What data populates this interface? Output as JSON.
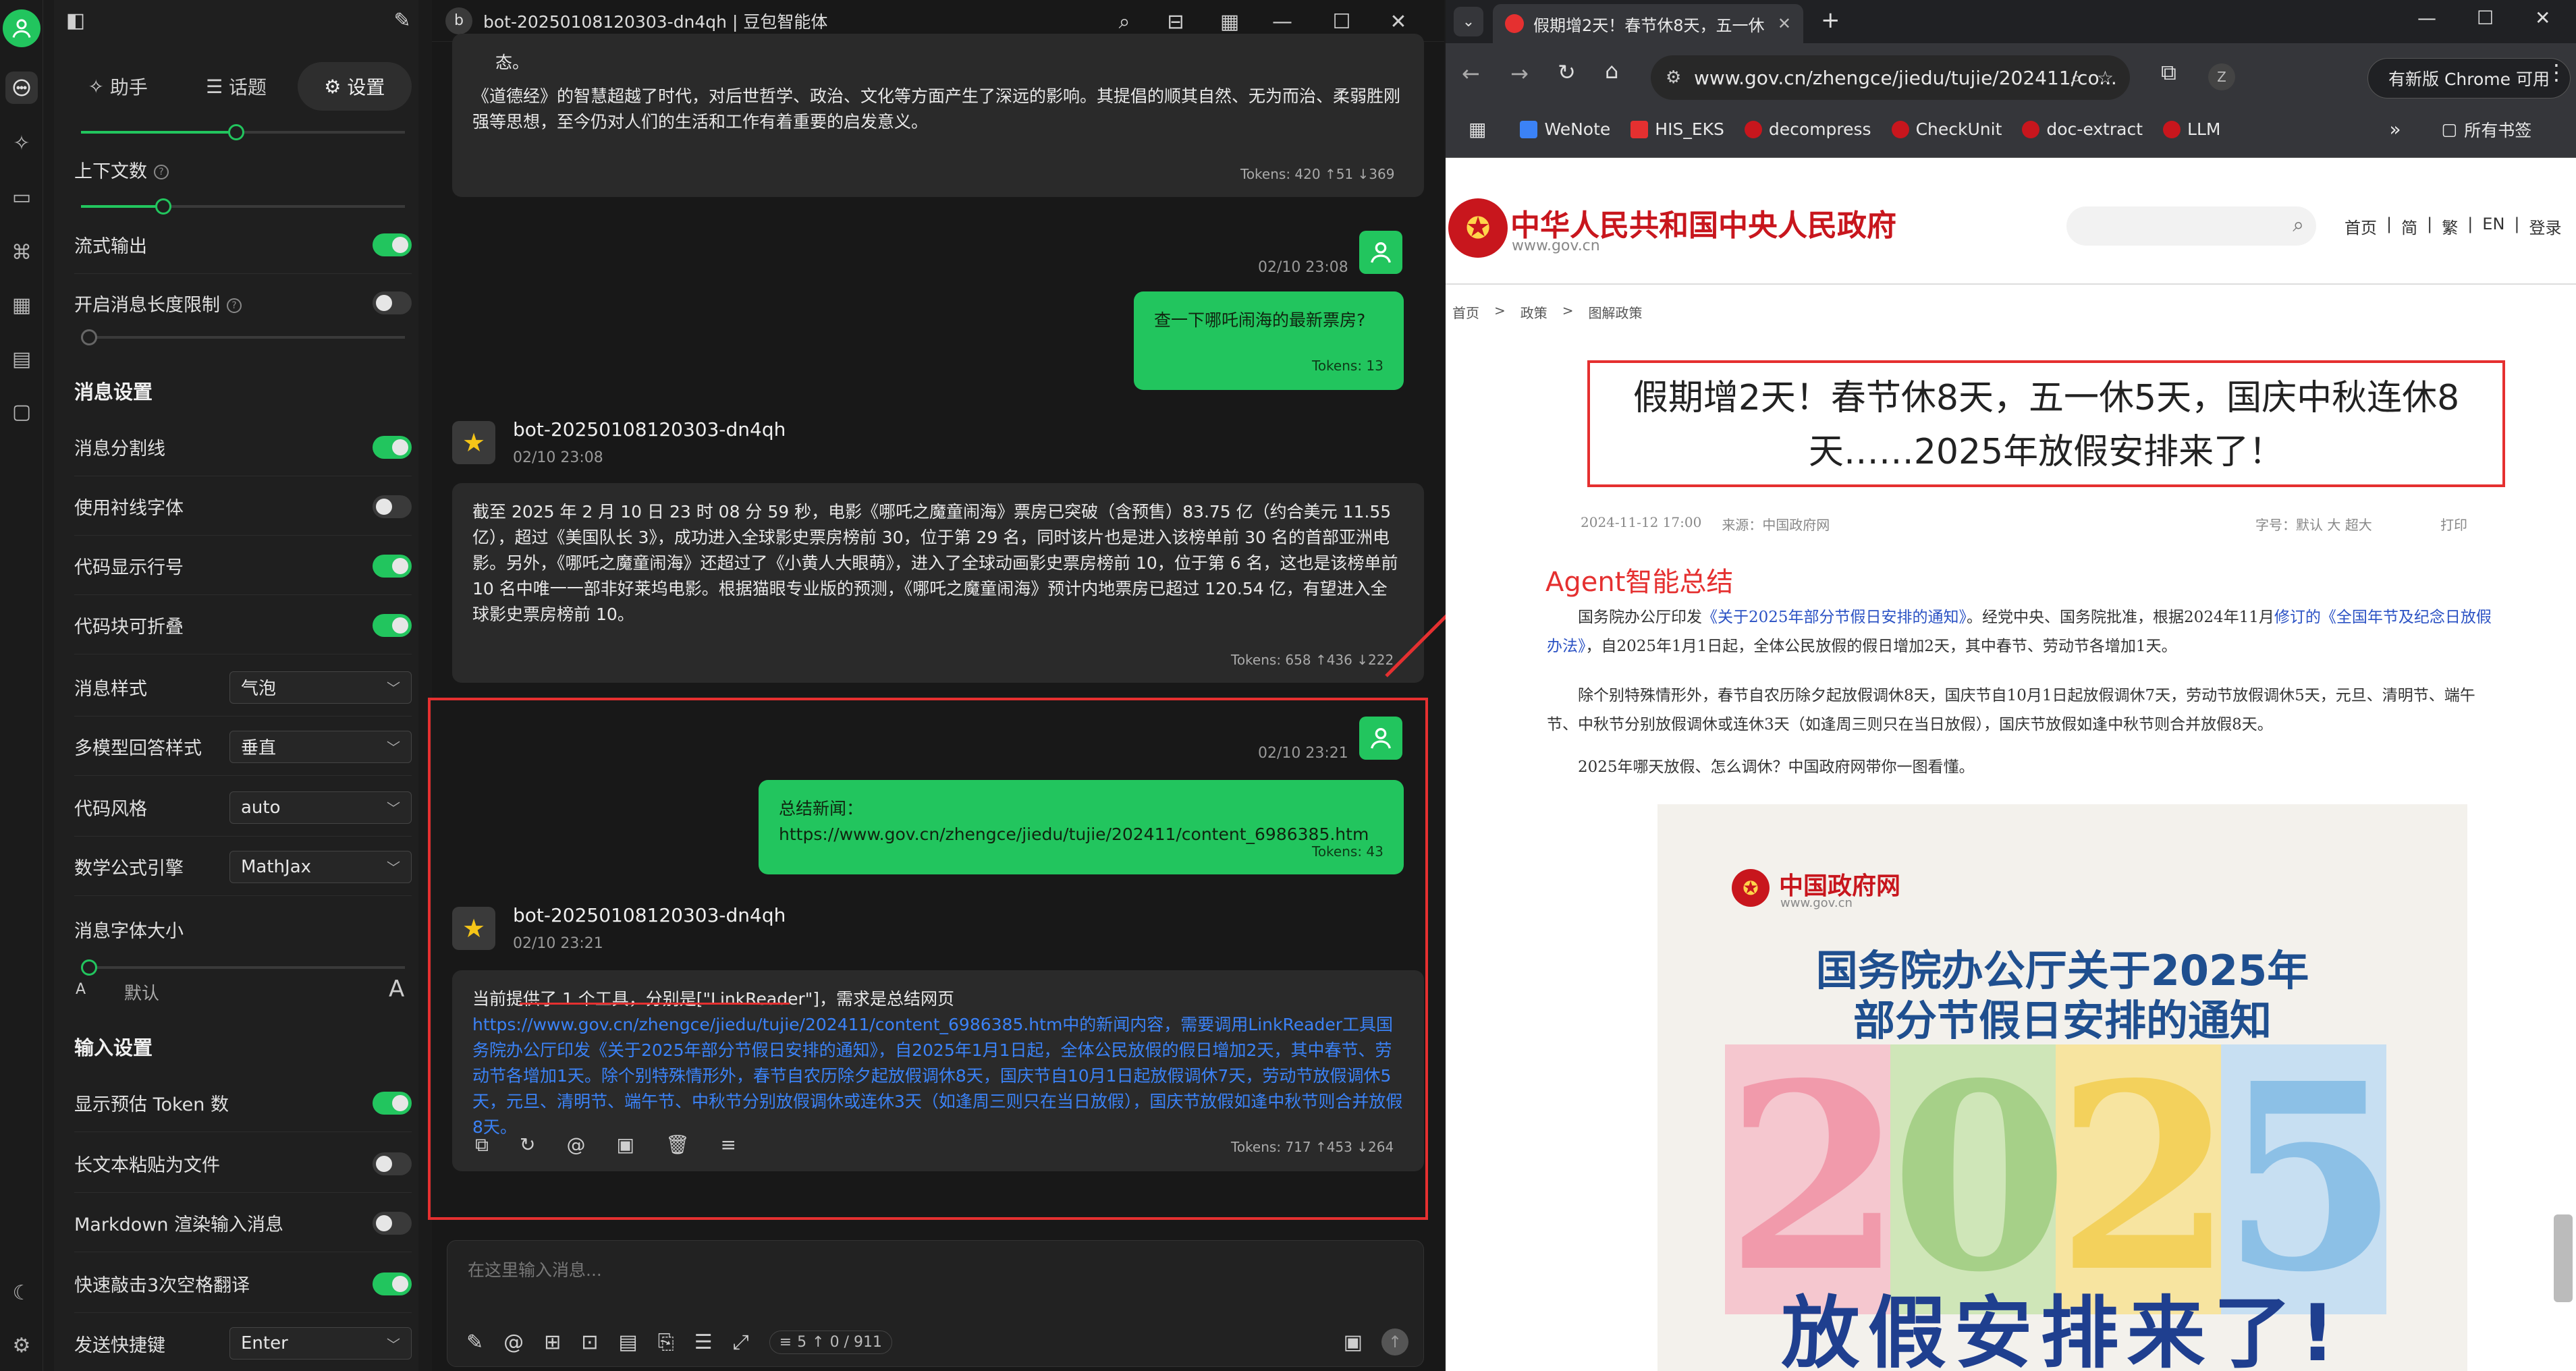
{
  "settings": {
    "tabs": [
      {
        "icon": "✧",
        "label": "助手"
      },
      {
        "icon": "☰",
        "label": "话题"
      },
      {
        "icon": "⚙",
        "label": "设置"
      }
    ],
    "context_label": "上下文数",
    "stream_label": "流式输出",
    "enable_limit_label": "开启消息长度限制",
    "msg_section": "消息设置",
    "rows": {
      "divider": "消息分割线",
      "serif": "使用衬线字体",
      "code_line": "代码显示行号",
      "code_fold": "代码块可折叠",
      "msg_style": "消息样式",
      "msg_style_val": "气泡",
      "multi_model": "多模型回答样式",
      "multi_model_val": "垂直",
      "code_style": "代码风格",
      "code_style_val": "auto",
      "math": "数学公式引擎",
      "math_val": "MathJax",
      "font_size": "消息字体大小",
      "font_small": "A",
      "font_default": "默认",
      "font_large": "A"
    },
    "input_section": "输入设置",
    "input_rows": {
      "token": "显示预估 Token 数",
      "paste_file": "长文本粘贴为文件",
      "markdown": "Markdown 渲染输入消息",
      "translate": "快速敲击3次空格翻译",
      "send_key": "发送快捷键",
      "send_key_val": "Enter"
    }
  },
  "chat": {
    "title": "bot-20250108120303-dn4qh | 豆包智能体",
    "avatar_letter": "b",
    "msg0": {
      "text_line1": "态。",
      "text_line2": "《道德经》的智慧超越了时代，对后世哲学、政治、文化等方面产生了深远的影响。其提倡的顺其自然、无为而治、柔弱胜刚强等思想，至今仍对人们的生活和工作有着重要的启发意义。",
      "tokens": "Tokens: 420 ↑51 ↓369"
    },
    "user1": {
      "time": "02/10 23:08",
      "text": "查一下哪吒闹海的最新票房?",
      "tokens": "Tokens: 13"
    },
    "bot1": {
      "name": "bot-20250108120303-dn4qh",
      "time": "02/10 23:08",
      "text": "截至 2025 年 2 月 10 日 23 时 08 分 59 秒，电影《哪吒之魔童闹海》票房已突破（含预售）83.75 亿（约合美元 11.55 亿），超过《美国队长 3》，成功进入全球影史票房榜前 30，位于第 29 名，同时该片也是进入该榜单前 30 名的首部亚洲电影。另外，《哪吒之魔童闹海》还超过了《小黄人大眼萌》，进入了全球动画影史票房榜前 10，位于第 6 名，这也是该榜单前 10 名中唯一一部非好莱坞电影。根据猫眼专业版的预测，《哪吒之魔童闹海》预计内地票房已超过 120.54 亿，有望进入全球影史票房榜前 10。",
      "tokens": "Tokens: 658 ↑436 ↓222"
    },
    "user2": {
      "time": "02/10 23:21",
      "text": "总结新闻：https://www.gov.cn/zhengce/jiedu/tujie/202411/content_6986385.htm",
      "tokens": "Tokens: 43"
    },
    "bot2": {
      "name": "bot-20250108120303-dn4qh",
      "time": "02/10 23:21",
      "line1": "当前提供了 1 个工具，分别是[\"LinkReader\"]，需求是总结网页",
      "body": "https://www.gov.cn/zhengce/jiedu/tujie/202411/content_6986385.htm中的新闻内容，需要调用LinkReader工具国务院办公厅印发《关于2025年部分节假日安排的通知》，自2025年1月1日起，全体公民放假的假日增加2天，其中春节、劳动节各增加1天。除个别特殊情形外，春节自农历除夕起放假调休8天，国庆节自10月1日起放假调休7天，劳动节放假调休5天，元旦、清明节、端午节、中秋节分别放假调休或连休3天（如逢周三则只在当日放假），国庆节放假如逢中秋节则合并放假8天。",
      "tokens": "Tokens: 717 ↑453 ↓264"
    },
    "input_placeholder": "在这里输入消息...",
    "counter_ctx": "5",
    "counter_tokens": "0 / 911"
  },
  "browser": {
    "tab_title": "假期增2天！春节休8天，五一休",
    "url": "www.gov.cn/zhengce/jiedu/tujie/202411/co...",
    "update_btn": "有新版 Chrome 可用",
    "profile_letter": "Z",
    "bookmarks": [
      {
        "label": "WeNote",
        "color": "#3b82f6"
      },
      {
        "label": "HIS_EKS",
        "color": "#e53030"
      },
      {
        "label": "decompress",
        "color": "#c8161d"
      },
      {
        "label": "CheckUnit",
        "color": "#c8161d"
      },
      {
        "label": "doc-extract",
        "color": "#c8161d"
      },
      {
        "label": "LLM",
        "color": "#c8161d"
      }
    ],
    "all_bookmarks": "所有书签",
    "page": {
      "site_title": "中华人民共和国中央人民政府",
      "site_domain": "www.gov.cn",
      "nav": [
        "首页",
        "|",
        "简",
        "|",
        "繁",
        "|",
        "EN",
        "|",
        "登录"
      ],
      "crumbs": [
        "首页",
        ">",
        "政策",
        ">",
        "图解政策"
      ],
      "article_title": "假期增2天！春节休8天，五一休5天，国庆中秋连休8天……2025年放假安排来了！",
      "meta_date": "2024-11-12 17:00",
      "meta_source_label": "来源：",
      "meta_source": "中国政府网",
      "meta_fontsize": "字号：默认  大  超大",
      "meta_print": "打印",
      "agent_label": "Agent智能总结",
      "p1_pre": "国务院办公厅印发",
      "p1_link1": "《关于2025年部分节假日安排的通知》",
      "p1_mid": "。经党中央、国务院批准，根据2024年11月",
      "p1_link2": "修订的《全国年节及纪念日放假办法》",
      "p1_post": "，自2025年1月1日起，全体公民放假的假日增加2天，其中春节、劳动节各增加1天。",
      "p2": "除个别特殊情形外，春节自农历除夕起放假调休8天，国庆节自10月1日起放假调休7天，劳动节放假调休5天，元旦、清明节、端午节、中秋节分别放假调休或连休3天（如逢周三则只在当日放假），国庆节放假如逢中秋节则合并放假8天。",
      "p3": "2025年哪天放假、怎么调休？中国政府网带你一图看懂。",
      "poster_brand": "中国政府网",
      "poster_brand_sub": "www.gov.cn",
      "poster_h1": "国务院办公厅关于2025年",
      "poster_h2": "部分节假日安排的通知",
      "poster_digits": [
        "2",
        "0",
        "2",
        "5"
      ],
      "poster_foot": "放假安排来了!"
    }
  },
  "colors": {
    "accent_green": "#22c55e",
    "annotation_red": "#e53030",
    "gov_red": "#c8161d"
  }
}
